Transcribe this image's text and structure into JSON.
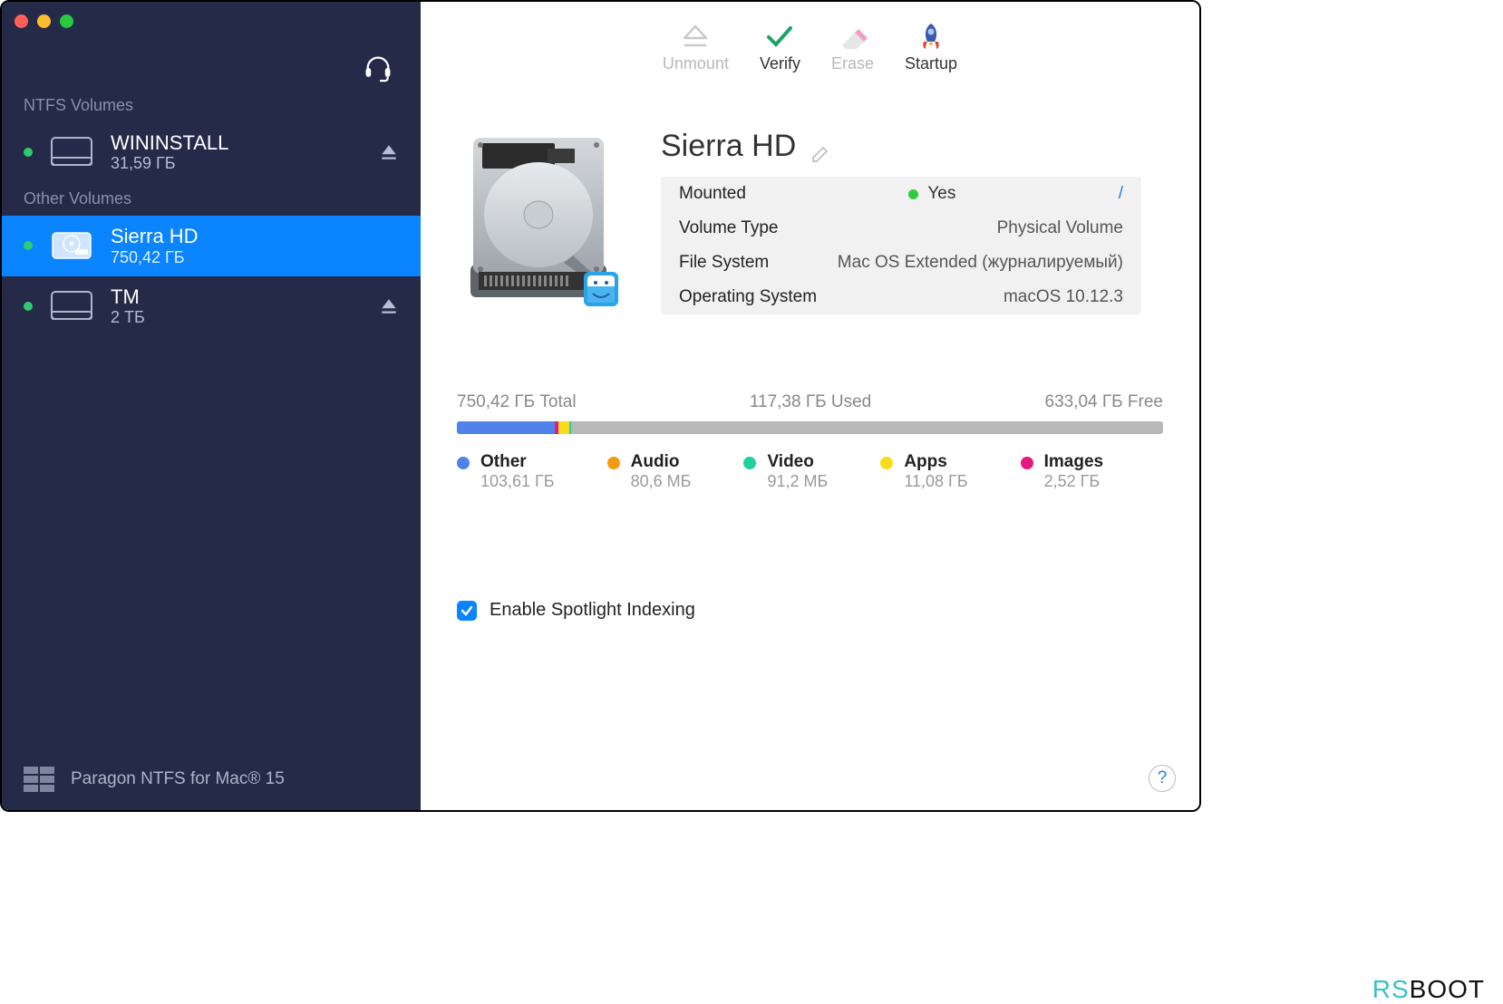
{
  "sidebar": {
    "sections": [
      {
        "label": "NTFS Volumes"
      },
      {
        "label": "Other Volumes"
      }
    ],
    "volumes": {
      "wininstall": {
        "name": "WININSTALL",
        "size": "31,59 ГБ"
      },
      "sierra": {
        "name": "Sierra HD",
        "size": "750,42 ГБ"
      },
      "tm": {
        "name": "TM",
        "size": "2 ТБ"
      }
    },
    "footer": "Paragon NTFS for Mac® 15"
  },
  "toolbar": {
    "unmount": "Unmount",
    "verify": "Verify",
    "erase": "Erase",
    "startup": "Startup"
  },
  "volume": {
    "title": "Sierra HD",
    "info": {
      "mounted_label": "Mounted",
      "mounted_value": "Yes",
      "mount_path": "/",
      "type_label": "Volume Type",
      "type_value": "Physical Volume",
      "fs_label": "File System",
      "fs_value": "Mac OS Extended (журналируемый)",
      "os_label": "Operating System",
      "os_value": "macOS 10.12.3"
    }
  },
  "usage": {
    "total": "750,42 ГБ Total",
    "used": "117,38 ГБ Used",
    "free": "633,04 ГБ Free",
    "legend": {
      "other": {
        "name": "Other",
        "size": "103,61 ГБ",
        "color": "#4f83ea"
      },
      "audio": {
        "name": "Audio",
        "size": "80,6 МБ",
        "color": "#f39c12"
      },
      "video": {
        "name": "Video",
        "size": "91,2 МБ",
        "color": "#1fcfa0"
      },
      "apps": {
        "name": "Apps",
        "size": "11,08 ГБ",
        "color": "#f7dc1e"
      },
      "images": {
        "name": "Images",
        "size": "2,52 ГБ",
        "color": "#e6177e"
      }
    }
  },
  "spotlight": {
    "label": "Enable Spotlight Indexing",
    "checked": true
  },
  "watermark": {
    "rs": "RS",
    "boot": "BOOT"
  },
  "help": "?"
}
